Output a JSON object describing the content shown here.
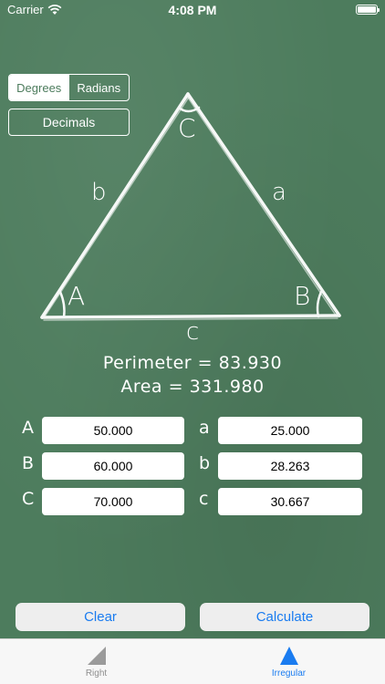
{
  "status_bar": {
    "carrier": "Carrier",
    "time": "4:08 PM"
  },
  "angle_mode": {
    "options": [
      "Degrees",
      "Radians"
    ],
    "selected": "Degrees"
  },
  "decimals_button": "Decimals",
  "triangle": {
    "vertex_labels": {
      "A": "A",
      "B": "B",
      "C": "C"
    },
    "side_labels": {
      "a": "a",
      "b": "b",
      "c": "c"
    }
  },
  "results": {
    "perimeter": "Perimeter = 83.930",
    "area": "Area = 331.980"
  },
  "inputs": {
    "angles": [
      {
        "label": "A",
        "value": "50.000"
      },
      {
        "label": "B",
        "value": "60.000"
      },
      {
        "label": "C",
        "value": "70.000"
      }
    ],
    "sides": [
      {
        "label": "a",
        "value": "25.000"
      },
      {
        "label": "b",
        "value": "28.263"
      },
      {
        "label": "c",
        "value": "30.667"
      }
    ]
  },
  "actions": {
    "clear": "Clear",
    "calculate": "Calculate"
  },
  "tabs": [
    {
      "label": "Right",
      "icon": "right-triangle-icon",
      "active": false
    },
    {
      "label": "Irregular",
      "icon": "irregular-triangle-icon",
      "active": true
    }
  ],
  "colors": {
    "chalkboard": "#4d7c5d",
    "accent": "#1a7cf0",
    "chalk": "#ffffff"
  }
}
